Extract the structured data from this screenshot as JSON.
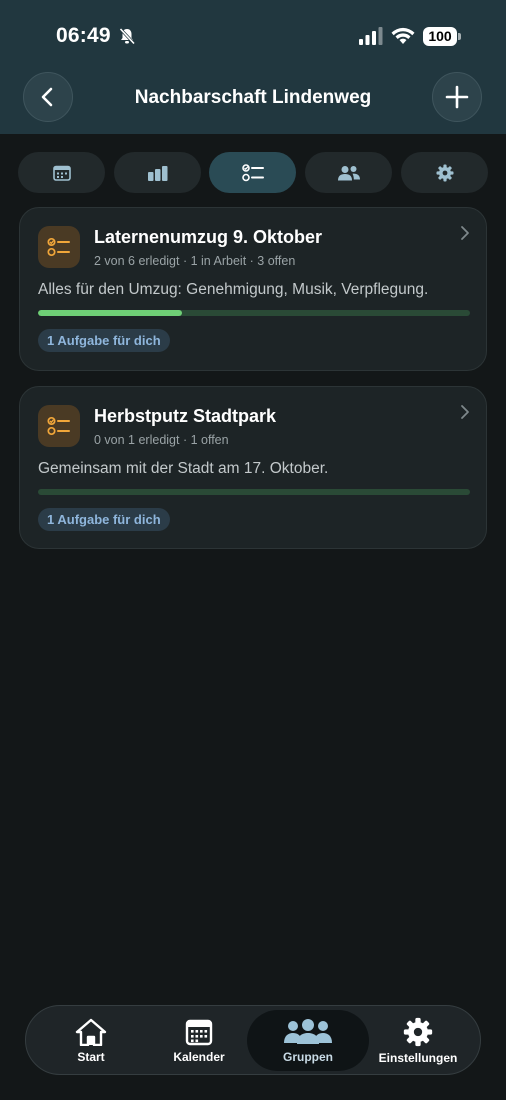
{
  "status_bar": {
    "time": "06:49",
    "battery": "100"
  },
  "header": {
    "title": "Nachbarschaft Lindenweg"
  },
  "tabs": [
    {
      "icon": "calendar-icon"
    },
    {
      "icon": "bar-chart-icon"
    },
    {
      "icon": "checklist-icon",
      "active": true
    },
    {
      "icon": "people-icon"
    },
    {
      "icon": "gear-icon"
    }
  ],
  "cards": [
    {
      "title": "Laternenumzug 9. Oktober",
      "subtitle": "2 von 6 erledigt · 1 in Arbeit · 3 offen",
      "description": "Alles für den Umzug: Genehmigung, Musik, Verpflegung.",
      "progress": 0.333,
      "badge": "1 Aufgabe für dich"
    },
    {
      "title": "Herbstputz Stadtpark",
      "subtitle": "0 von 1 erledigt · 1 offen",
      "description": "Gemeinsam mit der Stadt am 17. Oktober.",
      "progress": 0,
      "badge": "1 Aufgabe für dich"
    }
  ],
  "bottom_nav": [
    {
      "label": "Start",
      "icon": "home-icon"
    },
    {
      "label": "Kalender",
      "icon": "calendar-icon"
    },
    {
      "label": "Gruppen",
      "icon": "groups-icon",
      "active": true
    },
    {
      "label": "Einstellungen",
      "icon": "gear-icon"
    }
  ],
  "colors": {
    "accent": "#6fcf76",
    "header_bg": "#21373f",
    "page_bg": "#131718"
  }
}
